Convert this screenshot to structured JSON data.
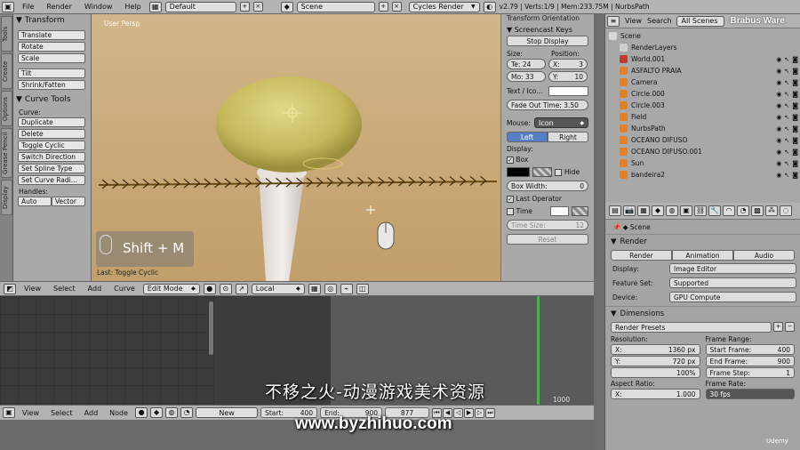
{
  "menu": [
    "File",
    "Render",
    "Window",
    "Help"
  ],
  "layout": "Default",
  "scene": "Scene",
  "engine": "Cycles Render",
  "stats": "v2.79 | Verts:1/9 | Mem:233.75M | NurbsPath",
  "shelf": {
    "tabs": [
      "Tools",
      "Create",
      "Options",
      "Grease Pencil",
      "Display"
    ],
    "transform_title": "Transform",
    "transform": [
      "Translate",
      "Rotate",
      "Scale",
      "Tilt",
      "Shrink/Fatten"
    ],
    "curve_tools_title": "Curve Tools",
    "curve_label": "Curve:",
    "curve": [
      "Duplicate",
      "Delete",
      "Toggle Cyclic",
      "Switch Direction",
      "Set Spline Type",
      "Set Curve Radi..."
    ],
    "handles_label": "Handles:",
    "handles": [
      "Auto",
      "Vector"
    ]
  },
  "viewport": {
    "label": "User Persp",
    "key_hint": "Shift + M",
    "last_op": "Last: Toggle Cyclic"
  },
  "screencast": {
    "transform_orientation": "Transform Orientation",
    "title": "Screencast Keys",
    "stop": "Stop Display",
    "size_label": "Size:",
    "position_label": "Position:",
    "te": "Te: 24",
    "mo": "Mo: 33",
    "x": "X:",
    "x_val": "3",
    "y": "Y:",
    "y_val": "10",
    "text_icon": "Text / Ico...",
    "fade": "Fade Out Time: 3.50",
    "mouse_label": "Mouse:",
    "mouse_val": "Icon",
    "left": "Left",
    "right": "Right",
    "display_label": "Display:",
    "box": "Box",
    "hide": "Hide",
    "box_width": "Box Width:",
    "box_width_val": "0",
    "last_operator": "Last Operator",
    "time": "Time",
    "time_size": "Time Size:",
    "time_size_val": "12",
    "reset": "Reset"
  },
  "vphead": {
    "items": [
      "View",
      "Select",
      "Add",
      "Curve"
    ],
    "mode": "Edit Mode",
    "pivot": "Local"
  },
  "timeline": {
    "frame_label": "1000"
  },
  "bottom": {
    "items": [
      "View",
      "Select",
      "Add",
      "Node"
    ],
    "new": "New",
    "start": "Start:",
    "start_val": "400",
    "end": "End:",
    "end_val": "900",
    "current": "877"
  },
  "outliner": {
    "view": "View",
    "search": "Search",
    "filter": "All Scenes",
    "watermark": "Brabus Ware",
    "items": [
      {
        "name": "Scene",
        "indent": 0,
        "color": "#d8d8d8"
      },
      {
        "name": "RenderLayers",
        "indent": 1,
        "color": "#cfcfcf"
      },
      {
        "name": "World.001",
        "indent": 1,
        "color": "#c0392b"
      },
      {
        "name": "ASFALTO PRAIA",
        "indent": 1,
        "color": "#e67e22"
      },
      {
        "name": "Camera",
        "indent": 1,
        "color": "#e67e22"
      },
      {
        "name": "Circle.000",
        "indent": 1,
        "color": "#e67e22"
      },
      {
        "name": "Circle.003",
        "indent": 1,
        "color": "#e67e22"
      },
      {
        "name": "Field",
        "indent": 1,
        "color": "#e67e22"
      },
      {
        "name": "NurbsPath",
        "indent": 1,
        "color": "#e67e22"
      },
      {
        "name": "OCEANO DIFUSO",
        "indent": 1,
        "color": "#e67e22"
      },
      {
        "name": "OCEANO DIFUSO.001",
        "indent": 1,
        "color": "#e67e22"
      },
      {
        "name": "Sun",
        "indent": 1,
        "color": "#e67e22"
      },
      {
        "name": "bandeira2",
        "indent": 1,
        "color": "#e67e22"
      }
    ]
  },
  "props": {
    "scene": "Scene",
    "render_title": "Render",
    "render_btn": "Render",
    "animation_btn": "Animation",
    "audio_btn": "Audio",
    "display_label": "Display:",
    "display_val": "Image Editor",
    "feature_label": "Feature Set:",
    "feature_val": "Supported",
    "device_label": "Device:",
    "device_val": "GPU Compute",
    "dimensions_title": "Dimensions",
    "presets": "Render Presets",
    "resolution": "Resolution:",
    "res_x": "X:",
    "res_x_val": "1360 px",
    "res_y": "Y:",
    "res_y_val": "720 px",
    "res_pct": "100%",
    "frame_range": "Frame Range:",
    "start_frame": "Start Frame:",
    "start_frame_val": "400",
    "end_frame": "End Frame:",
    "end_frame_val": "900",
    "frame_step": "Frame Step:",
    "frame_step_val": "1",
    "aspect": "Aspect Ratio:",
    "aspect_x": "X:",
    "aspect_x_val": "1.000",
    "frame_rate": "Frame Rate:",
    "frame_rate_val": "30 fps"
  },
  "overlay": {
    "subtitle": "不移之火-动漫游戏美术资源",
    "site": "www.byzhihuo.com",
    "udemy": "Udemy"
  }
}
